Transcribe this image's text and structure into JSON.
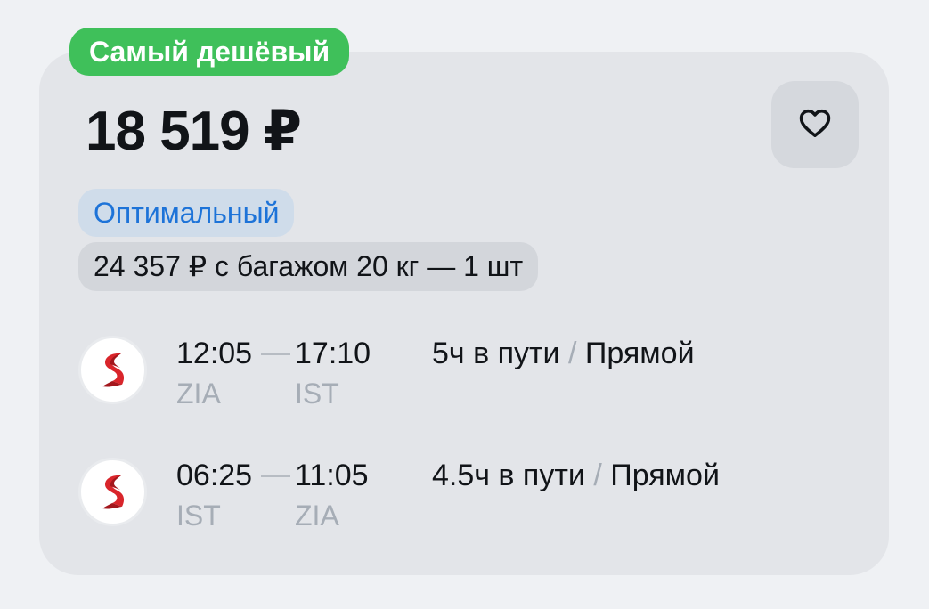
{
  "badge": {
    "label": "Самый дешёвый",
    "color": "#3fc05a"
  },
  "offer": {
    "price": "18 519 ₽"
  },
  "favorite": {
    "icon": "heart-icon"
  },
  "tariff": {
    "label": "Оптимальный",
    "color": "#1d73d8"
  },
  "baggage": {
    "label": "24 357 ₽ с багажом 20 кг — 1 шт"
  },
  "segments": [
    {
      "airline_icon": "airline-logo-s",
      "departure_time": "12:05",
      "arrival_time": "17:10",
      "departure_code": "ZIA",
      "arrival_code": "IST",
      "duration": "5ч в пути",
      "separator": "/",
      "stops": "Прямой"
    },
    {
      "airline_icon": "airline-logo-s",
      "departure_time": "06:25",
      "arrival_time": "11:05",
      "departure_code": "IST",
      "arrival_code": "ZIA",
      "duration": "4.5ч в пути",
      "separator": "/",
      "stops": "Прямой"
    }
  ]
}
